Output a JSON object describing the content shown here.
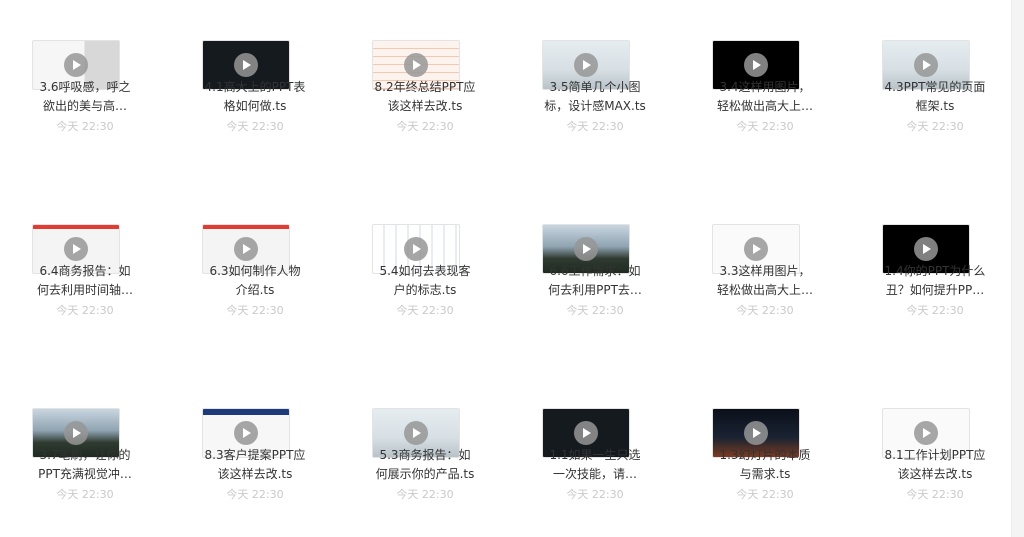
{
  "items": [
    {
      "title": "3.6呼吸感，呼之\n欲出的美与高…",
      "time": "今天 22:30",
      "thumb": "bg-doc"
    },
    {
      "title": "4.1高大上的PPT表\n格如何做.ts",
      "time": "今天 22:30",
      "thumb": "bg-dark"
    },
    {
      "title": "8.2年终总结PPT应\n该这样去改.ts",
      "time": "今天 22:30",
      "thumb": "bg-table"
    },
    {
      "title": "3.5简单几个小图\n标，设计感MAX.ts",
      "time": "今天 22:30",
      "thumb": "bg-sky"
    },
    {
      "title": "3.4这样用图片，\n轻松做出高大上…",
      "time": "今天 22:30",
      "thumb": "bg-black"
    },
    {
      "title": "4.3PPT常见的页面\n框架.ts",
      "time": "今天 22:30",
      "thumb": "bg-sky"
    },
    {
      "title": "6.4商务报告：如\n何去利用时间轴…",
      "time": "今天 22:30",
      "thumb": "bg-slides"
    },
    {
      "title": "6.3如何制作人物\n介绍.ts",
      "time": "今天 22:30",
      "thumb": "bg-slides"
    },
    {
      "title": "5.4如何去表现客\n户的标志.ts",
      "time": "今天 22:30",
      "thumb": "bg-logos"
    },
    {
      "title": "6.6工作需求：如\n何去利用PPT去…",
      "time": "今天 22:30",
      "thumb": "bg-mountain"
    },
    {
      "title": "3.3这样用图片，\n轻松做出高大上…",
      "time": "今天 22:30",
      "thumb": "bg-white"
    },
    {
      "title": "1.4你的PPT为什么\n丑？如何提升PP…",
      "time": "今天 22:30",
      "thumb": "bg-black"
    },
    {
      "title": "3.7笔刷，让你的\nPPT充满视觉冲…",
      "time": "今天 22:30",
      "thumb": "bg-mountain"
    },
    {
      "title": "8.3客户提案PPT应\n该这样去改.ts",
      "time": "今天 22:30",
      "thumb": "bg-ppt"
    },
    {
      "title": "5.3商务报告：如\n何展示你的产品.ts",
      "time": "今天 22:30",
      "thumb": "bg-sky"
    },
    {
      "title": "1.1如果一生只选\n一次技能，请…",
      "time": "今天 22:30",
      "thumb": "bg-dark"
    },
    {
      "title": "1.3幻灯片的本质\n与需求.ts",
      "time": "今天 22:30",
      "thumb": "bg-night"
    },
    {
      "title": "8.1工作计划PPT应\n该这样去改.ts",
      "time": "今天 22:30",
      "thumb": "bg-white"
    }
  ]
}
